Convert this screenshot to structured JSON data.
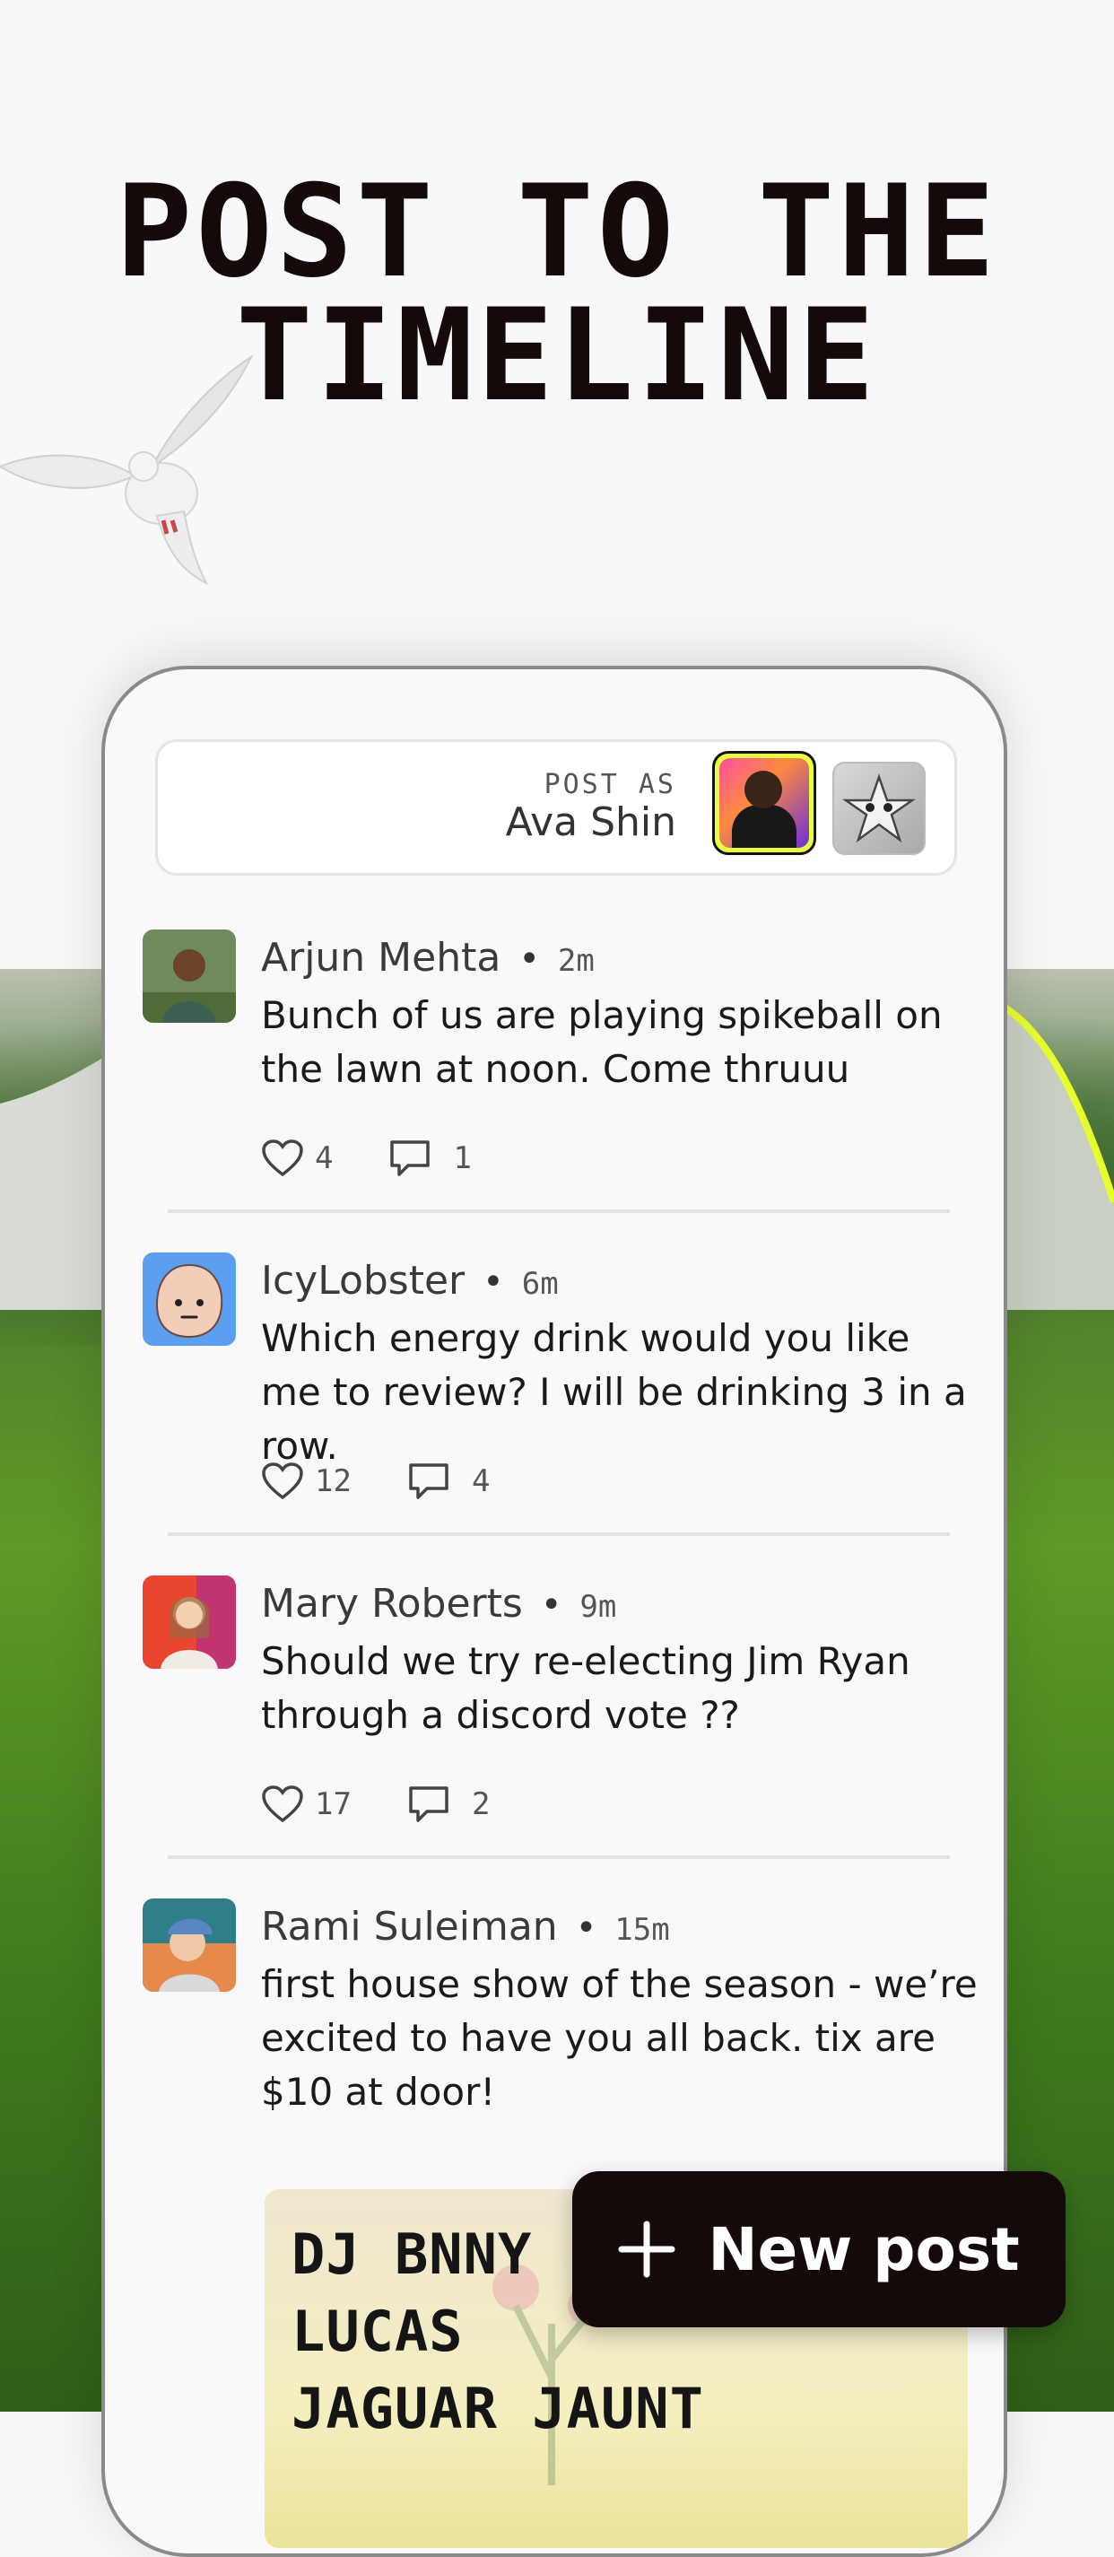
{
  "headline": {
    "line1": "POST TO THE",
    "line2": "TIMELINE"
  },
  "composer": {
    "caption": "POST AS",
    "name": "Ava Shin"
  },
  "posts": [
    {
      "author": "Arjun Mehta",
      "time": "2m",
      "body": "Bunch of us are playing spikeball on the lawn at noon. Come thruuu",
      "likes": "4",
      "comments": "1"
    },
    {
      "author": "IcyLobster",
      "time": "6m",
      "body": "Which energy drink would you like me to review? I will be drinking 3 in a row.",
      "likes": "12",
      "comments": "4"
    },
    {
      "author": "Mary Roberts",
      "time": "9m",
      "body": "Should we try re-electing Jim Ryan through a discord vote ??",
      "likes": "17",
      "comments": "2"
    },
    {
      "author": "Rami Suleiman",
      "time": "15m",
      "body": "first house show of the season - we’re excited to have you all back. tix are $10 at door!",
      "flyer": {
        "line1": "DJ BNNY",
        "line2": "LUCAS",
        "line3": "JAGUAR JAUNT"
      }
    }
  ],
  "fab": {
    "label": "New post",
    "icon": "plus-icon"
  },
  "colors": {
    "accent": "#e8ff3a",
    "ink": "#140a0a",
    "field": "#5e9a26"
  }
}
